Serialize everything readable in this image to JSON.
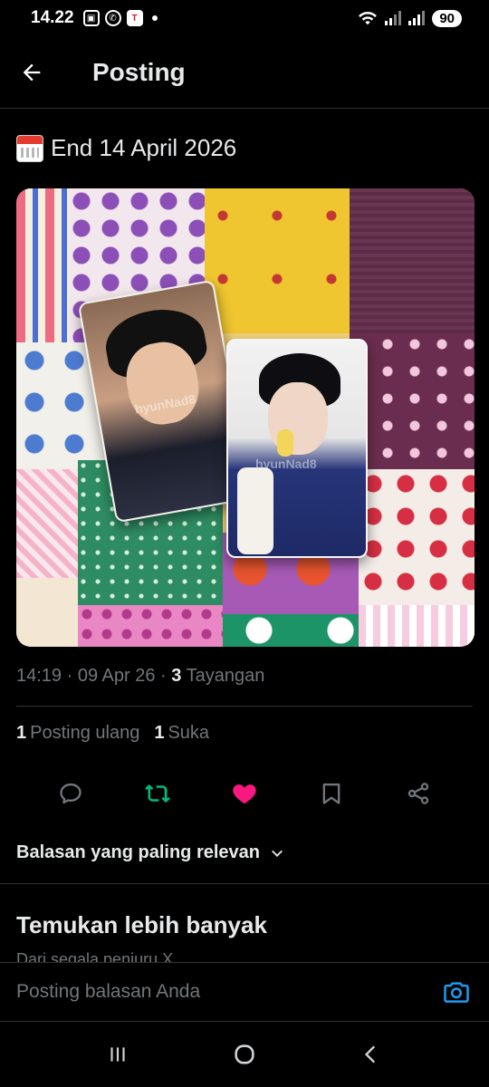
{
  "status_bar": {
    "time": "14.22",
    "battery": "90"
  },
  "header": {
    "title": "Posting"
  },
  "post": {
    "text": "End 14 April 2026",
    "watermark_1": "hyunNad8",
    "watermark_2": "hyunNad8",
    "time": "14:19",
    "date": "09 Apr 26",
    "views_count": "3",
    "views_label": "Tayangan"
  },
  "stats": {
    "reposts_count": "1",
    "reposts_label": "Posting ulang",
    "likes_count": "1",
    "likes_label": "Suka"
  },
  "actions": {
    "reply_icon": "reply-icon",
    "repost_icon": "repost-icon",
    "like_icon": "heart-icon",
    "bookmark_icon": "bookmark-icon",
    "share_icon": "share-icon",
    "repost_color": "#00ba7c",
    "like_color": "#f91880"
  },
  "replies": {
    "sort_label": "Balasan yang paling relevan"
  },
  "discover": {
    "title": "Temukan lebih banyak",
    "subtitle": "Dari segala penjuru X"
  },
  "reply_bar": {
    "placeholder": "Posting balasan Anda",
    "accent": "#1d9bf0"
  }
}
